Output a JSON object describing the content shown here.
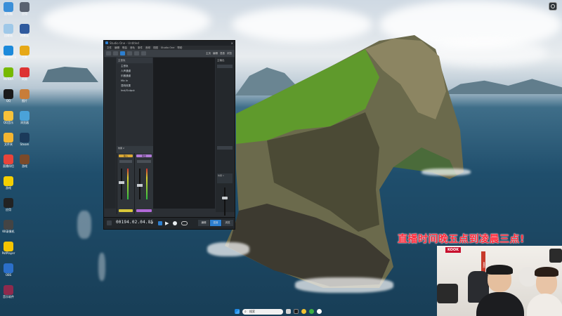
{
  "desktop": {
    "icons": [
      {
        "name": "此电脑",
        "color": "#3b8fd8"
      },
      {
        "name": "回收站",
        "color": "#9fc8e8"
      },
      {
        "name": "Microsoft Edge",
        "color": "#1c8adb"
      },
      {
        "name": "NVIDIA",
        "color": "#76b900"
      },
      {
        "name": "QQ",
        "color": "#1a1a1a"
      },
      {
        "name": "QQ音乐",
        "color": "#f7c23a"
      },
      {
        "name": "文件夹",
        "color": "#f3b530"
      },
      {
        "name": "直播伴侣",
        "color": "#e8443a"
      },
      {
        "name": "游戏",
        "color": "#f4cf00"
      },
      {
        "name": "应用",
        "color": "#222"
      },
      {
        "name": "KK录像机",
        "color": "#444"
      },
      {
        "name": "PotPlayer",
        "color": "#f5c400"
      },
      {
        "name": "OBS",
        "color": "#2b6fc9"
      },
      {
        "name": "音乐软件",
        "color": "#8e2a4d"
      }
    ],
    "icons_col2": [
      {
        "name": "应用",
        "color": "#5a6270"
      },
      {
        "name": "网易云",
        "color": "#2f5a9e"
      },
      {
        "name": "工具",
        "color": "#e6a817"
      },
      {
        "name": "网易",
        "color": "#d33"
      },
      {
        "name": "图片",
        "color": "#c87d3a"
      },
      {
        "name": "浏览器",
        "color": "#4aa2d9"
      },
      {
        "name": "Steam",
        "color": "#1b3a5a"
      },
      {
        "name": "游戏",
        "color": "#7a4a2a"
      }
    ]
  },
  "daw": {
    "title": "Studio One - Untitled",
    "menu": [
      "文件",
      "编辑",
      "歌曲",
      "音轨",
      "事件",
      "音频",
      "视图",
      "Studio One",
      "帮助"
    ],
    "toolbar_labels": [
      "主页",
      "编辑",
      "混音",
      "浏览"
    ],
    "tracks": [
      "主音轨",
      "人声通道",
      "乐器通道",
      "Mic In",
      "混响效果",
      "Inst/Output"
    ],
    "right_panel_label": "主输出",
    "fx_labels": [
      "效果 1",
      "效果 2"
    ],
    "channel_chips": [
      "输入",
      "输出"
    ],
    "timecode": "00194.02.04.85",
    "tabs": [
      "编辑",
      "混音",
      "浏览"
    ]
  },
  "overlay_text": "直播时间晚五点到凌晨三点!",
  "webcam": {
    "sign_text": "KOOK",
    "banner_text": "直播中"
  },
  "taskbar": {
    "search_placeholder": "搜索"
  },
  "colors": {
    "overlay_red": "#ff2a3a",
    "daw_accent": "#2d7fd0",
    "timecode_text": "#e9eef2"
  }
}
